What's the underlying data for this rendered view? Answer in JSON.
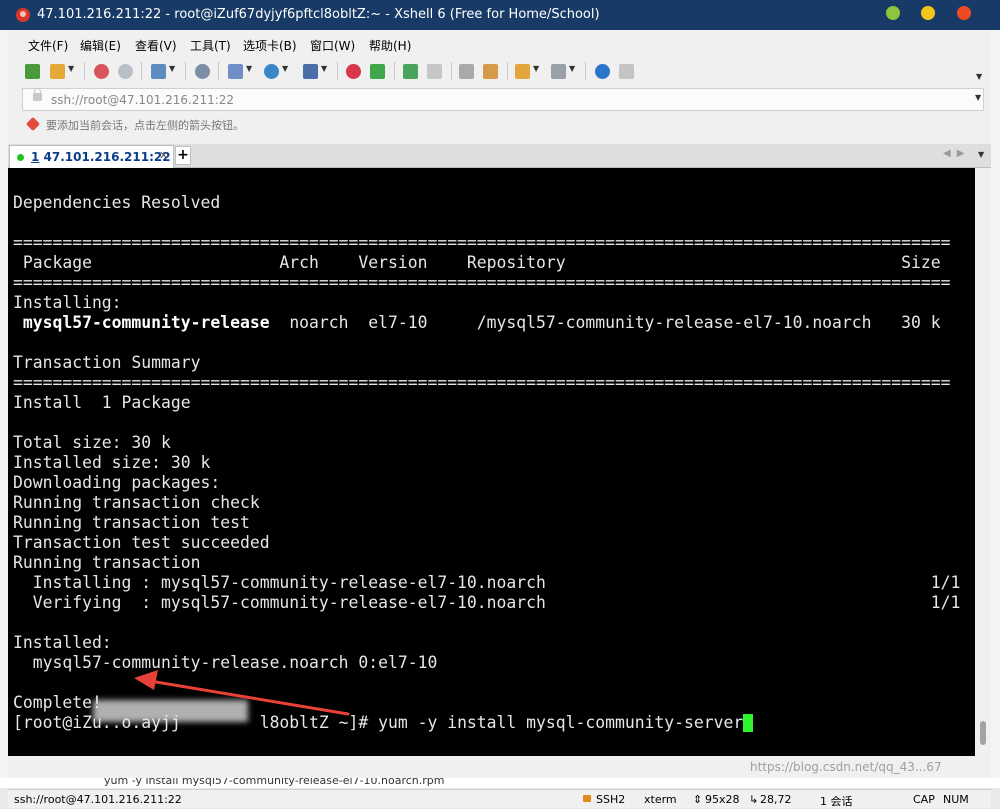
{
  "window": {
    "title": "47.101.216.211:22 - root@iZuf67dyjyf6pftcl8obltZ:~ - Xshell 6 (Free for Home/School)",
    "controls": {
      "minimize_color": "#8ec63f",
      "maximize_color": "#f3c41b",
      "close_color": "#ed4c23"
    }
  },
  "menubar": {
    "items": [
      "文件(F)",
      "编辑(E)",
      "查看(V)",
      "工具(T)",
      "选项卡(B)",
      "窗口(W)",
      "帮助(H)"
    ]
  },
  "toolbar": {
    "icons": [
      "new-session-icon",
      "open-folder-icon",
      "connect-icon",
      "disconnect-icon",
      "new-tab-icon",
      "find-icon",
      "properties-icon",
      "globe-icon",
      "font-icon",
      "xftp-icon",
      "xmanager-icon",
      "fullscreen-icon",
      "lock-icon",
      "keyboard-icon",
      "compose-icon",
      "transfer-icon",
      "layout-icon",
      "help-icon",
      "chat-icon"
    ]
  },
  "address": {
    "value": "ssh://root@47.101.216.211:22"
  },
  "hint": {
    "text": "要添加当前会话，点击左侧的箭头按钮。"
  },
  "tabs": [
    {
      "number": "1",
      "label": "47.101.216.211:22",
      "active": true
    }
  ],
  "terminal": {
    "lines": [
      {
        "text": "Dependencies Resolved",
        "bold": false
      },
      {
        "text": "",
        "bold": false
      },
      {
        "text": "===============================================================================================",
        "bold": false
      },
      {
        "text": " Package                   Arch    Version    Repository                                  Size",
        "bold": false
      },
      {
        "text": "===============================================================================================",
        "bold": false
      },
      {
        "text": "Installing:",
        "bold": false
      },
      {
        "text": " mysql57-community-release",
        "bold": true,
        "rest": "  noarch  el7-10     /mysql57-community-release-el7-10.noarch   30 k"
      },
      {
        "text": "",
        "bold": false
      },
      {
        "text": "Transaction Summary",
        "bold": false
      },
      {
        "text": "===============================================================================================",
        "bold": false
      },
      {
        "text": "Install  1 Package",
        "bold": false
      },
      {
        "text": "",
        "bold": false
      },
      {
        "text": "Total size: 30 k",
        "bold": false
      },
      {
        "text": "Installed size: 30 k",
        "bold": false
      },
      {
        "text": "Downloading packages:",
        "bold": false
      },
      {
        "text": "Running transaction check",
        "bold": false
      },
      {
        "text": "Running transaction test",
        "bold": false
      },
      {
        "text": "Transaction test succeeded",
        "bold": false
      },
      {
        "text": "Running transaction",
        "bold": false
      },
      {
        "text": "  Installing : mysql57-community-release-el7-10.noarch                                       1/1",
        "bold": false
      },
      {
        "text": "  Verifying  : mysql57-community-release-el7-10.noarch                                       1/1",
        "bold": false
      },
      {
        "text": "",
        "bold": false
      },
      {
        "text": "Installed:",
        "bold": false
      },
      {
        "text": "  mysql57-community-release.noarch 0:el7-10",
        "bold": false
      },
      {
        "text": "",
        "bold": false
      },
      {
        "text": "Complete!",
        "bold": false
      }
    ],
    "prompt": "[root@iZu..o.ayjj        l8obltZ ~]# ",
    "command": "yum -y install mysql-community-server",
    "cursor_color": "#2df52d",
    "annotation_color": "#e8413a"
  },
  "statusbar": {
    "connection": "ssh://root@47.101.216.211:22",
    "protocol": "SSH2",
    "terminal_type": "xterm",
    "size": "95x28",
    "cursor_pos": "28,72",
    "sessions": "1 会话",
    "caps": "CAP",
    "num": "NUM"
  },
  "watermark": "https://blog.csdn.net/qq_43...67",
  "background": {
    "partial_text": "yum -y install mysql57-community-release-el7-10.noarch.rpm"
  }
}
